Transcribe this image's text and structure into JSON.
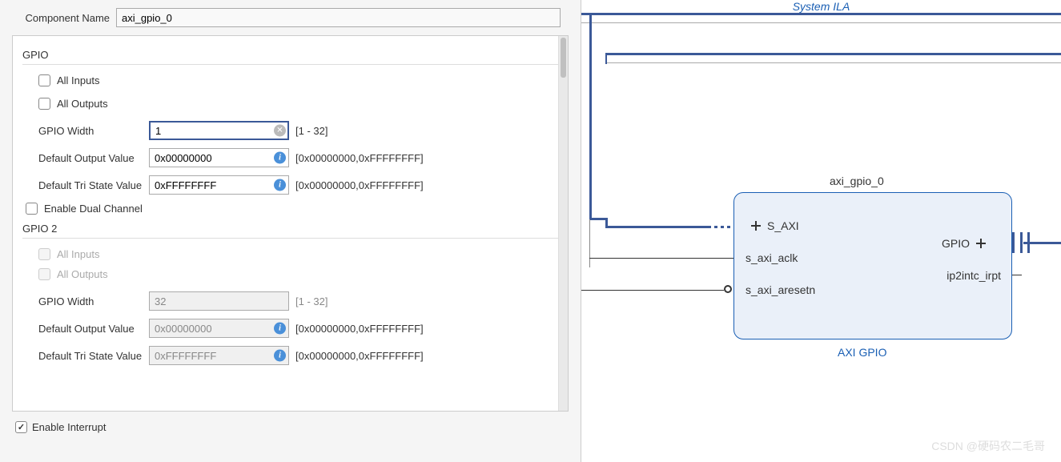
{
  "header": {
    "component_name_label": "Component Name",
    "component_name_value": "axi_gpio_0"
  },
  "gpio1": {
    "title": "GPIO",
    "all_inputs": "All Inputs",
    "all_outputs": "All Outputs",
    "width_label": "GPIO Width",
    "width_value": "1",
    "width_range": "[1 - 32]",
    "default_output_label": "Default Output Value",
    "default_output_value": "0x00000000",
    "default_output_range": "[0x00000000,0xFFFFFFFF]",
    "default_tri_label": "Default Tri State Value",
    "default_tri_value": "0xFFFFFFFF",
    "default_tri_range": "[0x00000000,0xFFFFFFFF]"
  },
  "dual_channel": "Enable Dual Channel",
  "gpio2": {
    "title": "GPIO 2",
    "all_inputs": "All Inputs",
    "all_outputs": "All Outputs",
    "width_label": "GPIO Width",
    "width_value": "32",
    "width_range": "[1 - 32]",
    "default_output_label": "Default Output Value",
    "default_output_value": "0x00000000",
    "default_output_range": "[0x00000000,0xFFFFFFFF]",
    "default_tri_label": "Default Tri State Value",
    "default_tri_value": "0xFFFFFFFF",
    "default_tri_range": "[0x00000000,0xFFFFFFFF]"
  },
  "enable_interrupt": "Enable Interrupt",
  "diagram": {
    "top_label": "System ILA",
    "block_name": "axi_gpio_0",
    "block_type": "AXI GPIO",
    "ports": {
      "s_axi": "S_AXI",
      "aclk": "s_axi_aclk",
      "aresetn": "s_axi_aresetn",
      "gpio": "GPIO",
      "irpt": "ip2intc_irpt"
    }
  },
  "watermark": "CSDN @硬码农二毛哥"
}
